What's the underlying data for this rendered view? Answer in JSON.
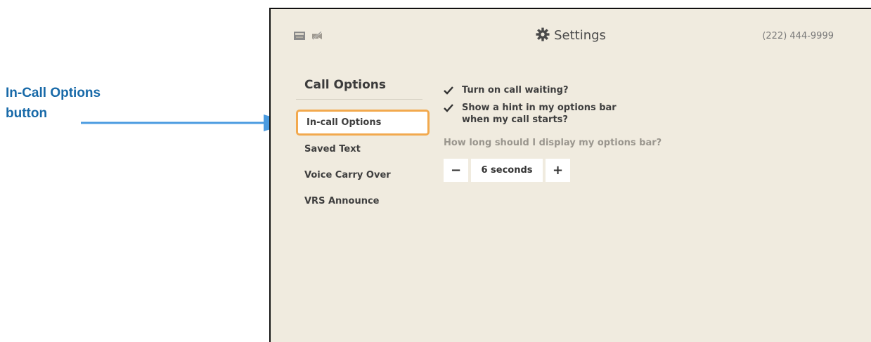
{
  "callout": {
    "line1": "In-Call Options",
    "line2": "button",
    "color": "#1769a8",
    "arrow_color": "#4a9be0"
  },
  "header": {
    "title": "Settings",
    "title_icon": "gear-icon",
    "phone_number": "(222) 444-9999",
    "status_icons": [
      "mail-icon",
      "video-off-icon"
    ]
  },
  "sidebar": {
    "heading": "Call Options",
    "items": [
      {
        "label": "In-call Options",
        "selected": true
      },
      {
        "label": "Saved Text",
        "selected": false
      },
      {
        "label": "Voice Carry Over",
        "selected": false
      },
      {
        "label": "VRS Announce",
        "selected": false
      }
    ],
    "selected_border_color": "#f2a94e"
  },
  "options": {
    "call_waiting": {
      "label": "Turn on call waiting?",
      "checked": true
    },
    "hint": {
      "line1": "Show a hint in my options bar",
      "line2": "when my call starts?",
      "checked": true
    },
    "duration_question": "How long should I display my options bar?",
    "duration": {
      "value": "6 seconds",
      "decrement": "−",
      "increment": "+"
    }
  },
  "colors": {
    "screen_bg": "#f0ebdf",
    "accent": "#f2a94e"
  }
}
